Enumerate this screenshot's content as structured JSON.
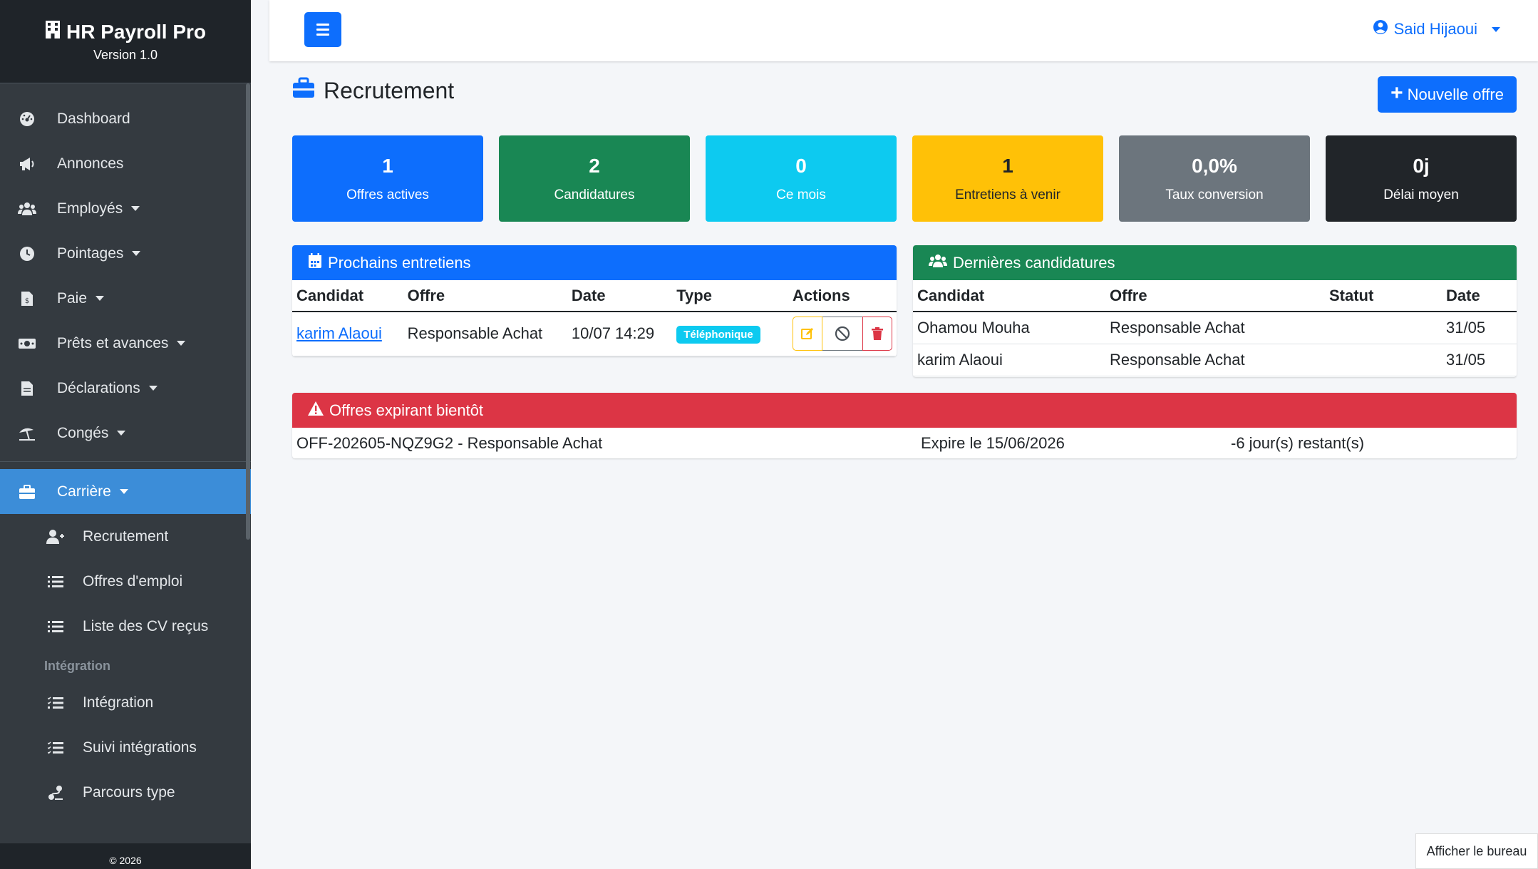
{
  "brand": {
    "title": "HR Payroll Pro",
    "version": "Version 1.0",
    "footer": "© 2026"
  },
  "sidebar": {
    "items": [
      {
        "label": "Dashboard",
        "icon": "tachometer-icon"
      },
      {
        "label": "Annonces",
        "icon": "megaphone-icon"
      },
      {
        "label": "Employés",
        "icon": "users-icon"
      },
      {
        "label": "Pointages",
        "icon": "clock-icon"
      },
      {
        "label": "Paie",
        "icon": "invoice-icon"
      },
      {
        "label": "Prêts et avances",
        "icon": "money-icon"
      },
      {
        "label": "Déclarations",
        "icon": "file-icon"
      },
      {
        "label": "Congés",
        "icon": "umbrella-beach-icon"
      }
    ],
    "active": {
      "label": "Carrière",
      "icon": "briefcase-icon"
    },
    "sub_items": [
      {
        "label": "Recrutement",
        "icon": "user-plus-icon"
      },
      {
        "label": "Offres d'emploi",
        "icon": "list-icon"
      },
      {
        "label": "Liste des CV reçus",
        "icon": "list-icon"
      }
    ],
    "section_header": "Intégration",
    "sub_items2": [
      {
        "label": "Intégration",
        "icon": "tasks-icon"
      },
      {
        "label": "Suivi intégrations",
        "icon": "tasks-icon"
      },
      {
        "label": "Parcours type",
        "icon": "route-icon"
      }
    ]
  },
  "topbar": {
    "user": "Said Hijaoui"
  },
  "page": {
    "title": "Recrutement",
    "new_button": "Nouvelle offre"
  },
  "stats": [
    {
      "value": "1",
      "label": "Offres actives",
      "color": "#0d6efd"
    },
    {
      "value": "2",
      "label": "Candidatures",
      "color": "#198754"
    },
    {
      "value": "0",
      "label": "Ce mois",
      "color": "#0dcaf0"
    },
    {
      "value": "1",
      "label": "Entretiens à venir",
      "color": "#ffc107"
    },
    {
      "value": "0,0%",
      "label": "Taux conversion",
      "color": "#6c757d"
    },
    {
      "value": "0j",
      "label": "Délai moyen",
      "color": "#212529"
    }
  ],
  "interviews": {
    "title": "Prochains entretiens",
    "headers": [
      "Candidat",
      "Offre",
      "Date",
      "Type",
      "Actions"
    ],
    "rows": [
      {
        "candidate": "karim Alaoui",
        "offer": "Responsable Achat",
        "date": "10/07 14:29",
        "type": "Téléphonique"
      }
    ]
  },
  "applications": {
    "title": "Dernières candidatures",
    "headers": [
      "Candidat",
      "Offre",
      "Statut",
      "Date"
    ],
    "rows": [
      {
        "candidate": "Ohamou Mouha",
        "offer": "Responsable Achat",
        "status": "",
        "date": "31/05"
      },
      {
        "candidate": "karim Alaoui",
        "offer": "Responsable Achat",
        "status": "",
        "date": "31/05"
      }
    ]
  },
  "expiring": {
    "title": "Offres expirant bientôt",
    "rows": [
      {
        "offer": "OFF-202605-NQZ9G2 - Responsable Achat",
        "expires": "Expire le 15/06/2026",
        "remaining": "-6 jour(s) restant(s)"
      }
    ]
  },
  "desktop_button": "Afficher le bureau"
}
